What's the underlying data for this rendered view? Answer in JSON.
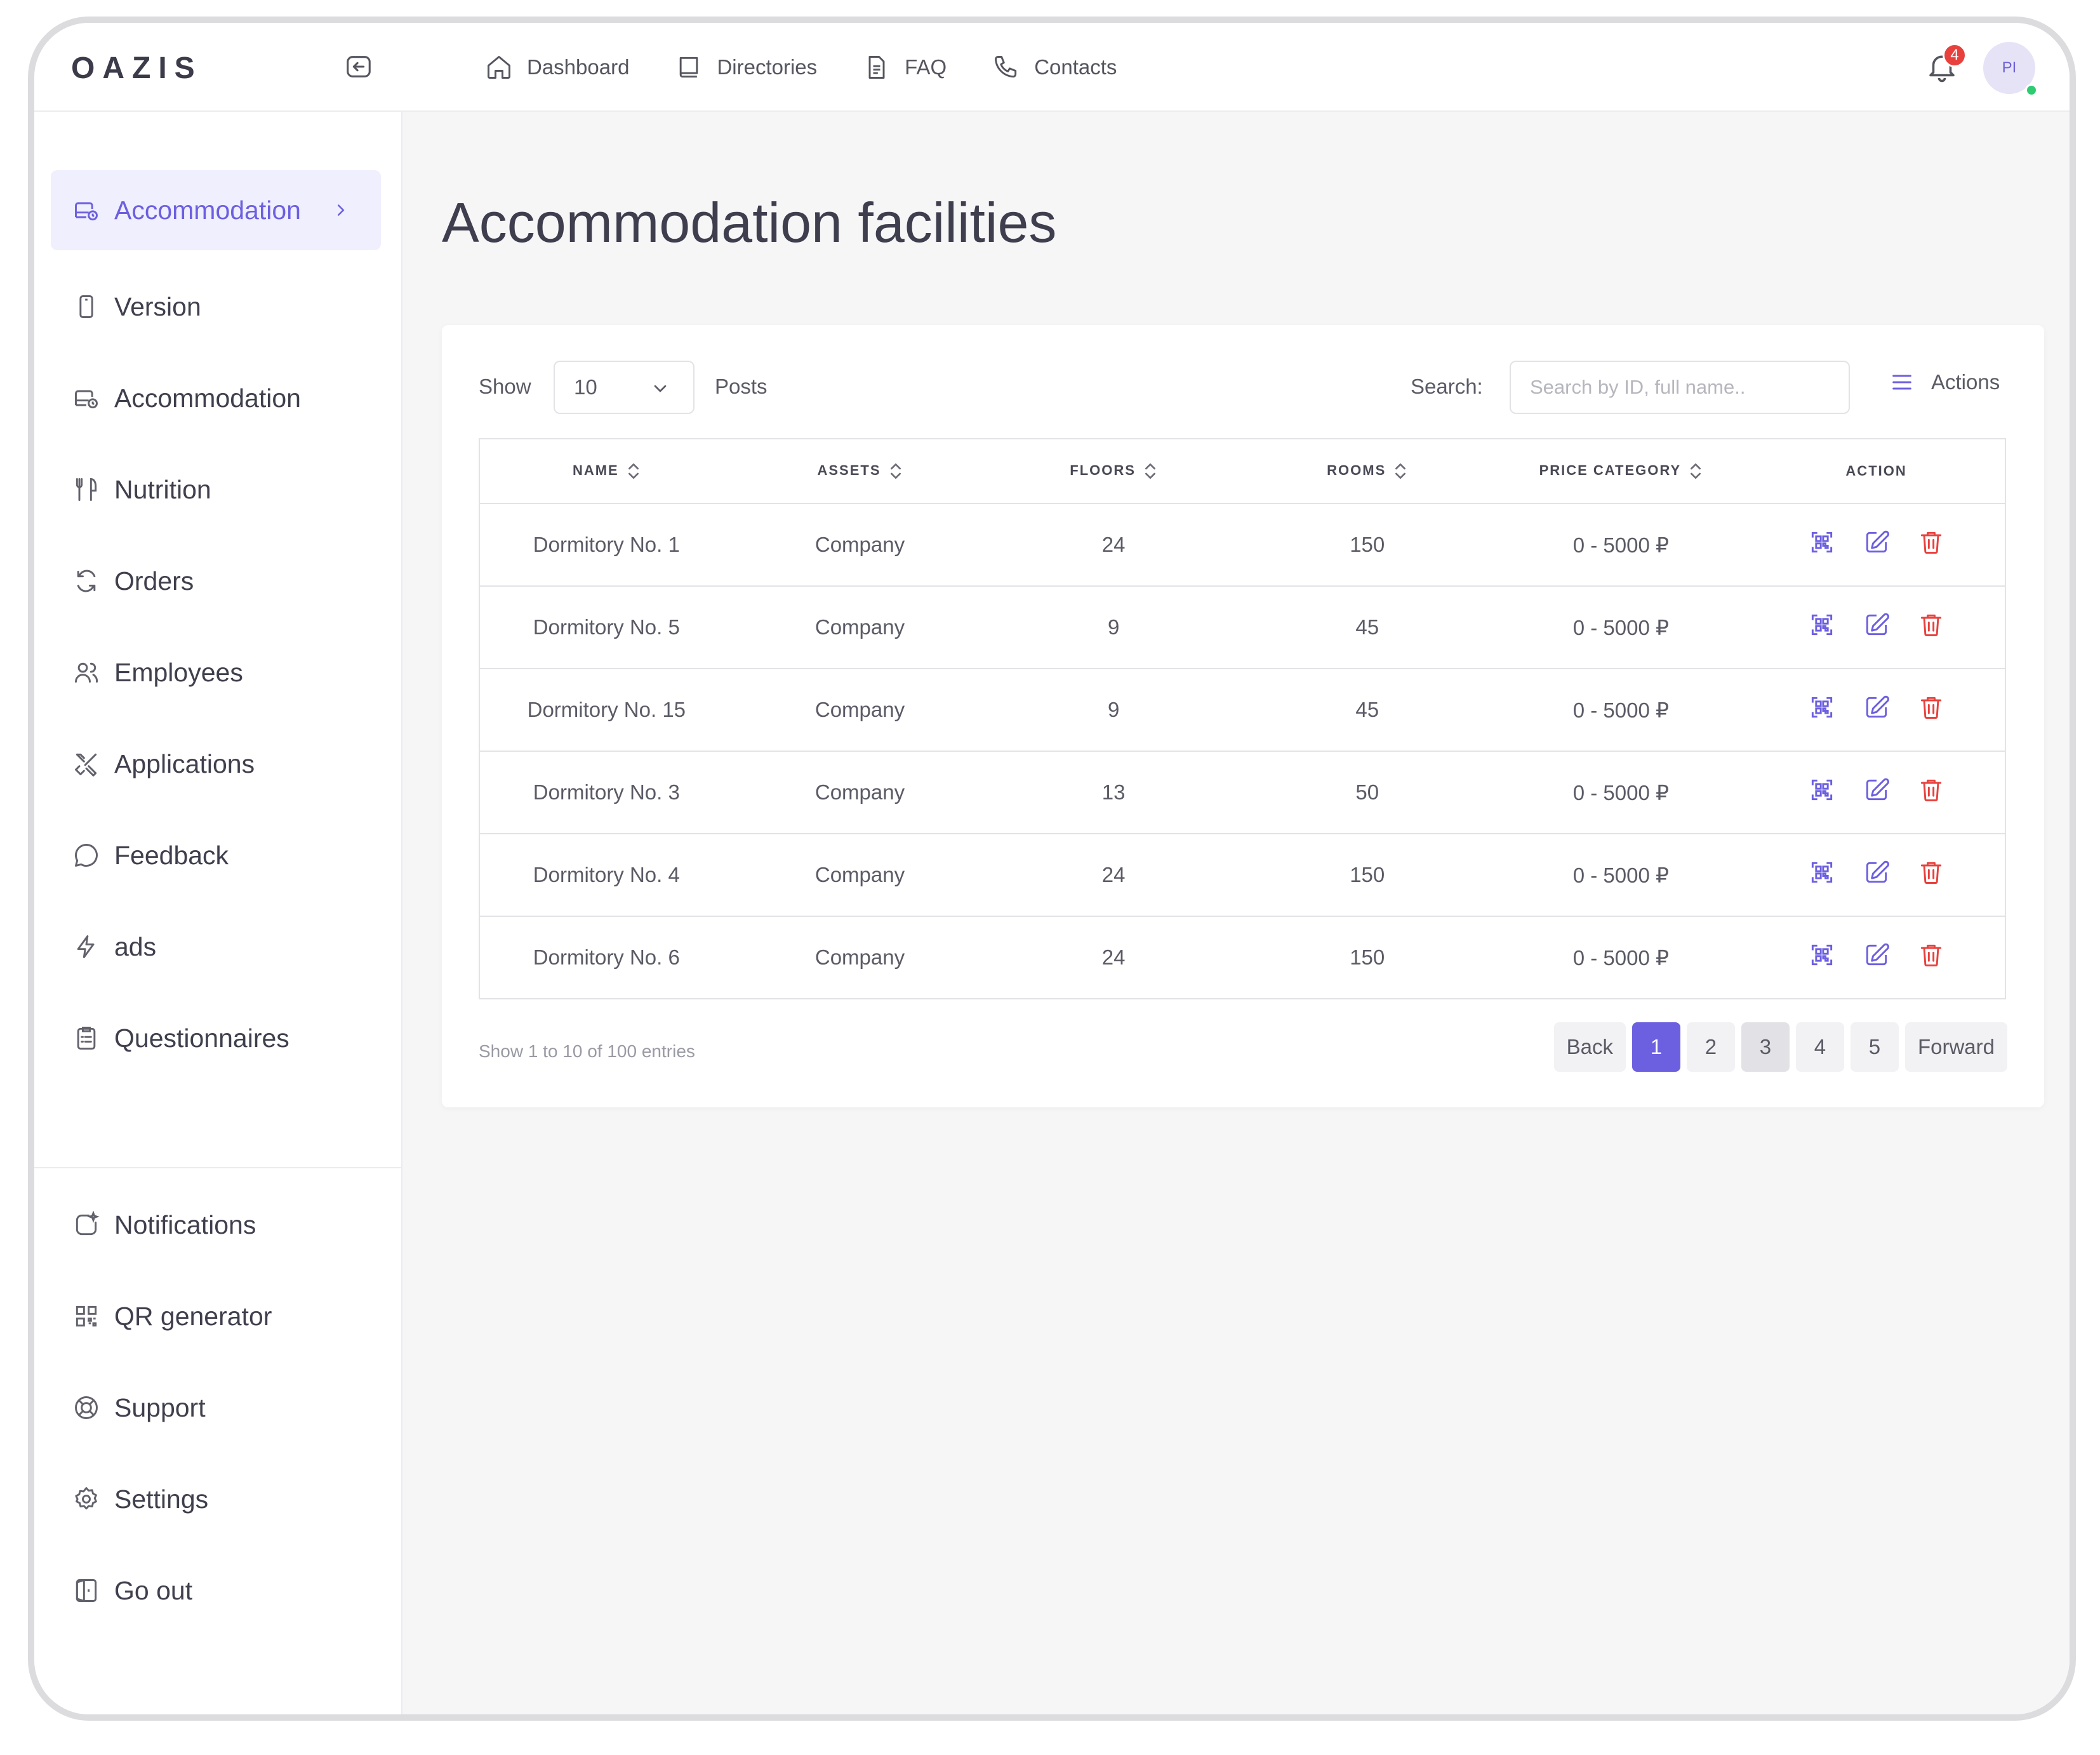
{
  "app": {
    "logo": "OAZIS"
  },
  "topnav": [
    {
      "label": "Dashboard"
    },
    {
      "label": "Directories"
    },
    {
      "label": "FAQ"
    },
    {
      "label": "Contacts"
    }
  ],
  "header": {
    "notifications_count": "4",
    "avatar_initials": "PI"
  },
  "sidebar": {
    "items": [
      {
        "label": "Accommodation",
        "icon": "bed-icon"
      },
      {
        "label": "Version",
        "icon": "phone-icon"
      },
      {
        "label": "Accommodation",
        "icon": "bed-icon"
      },
      {
        "label": "Nutrition",
        "icon": "utensils-icon"
      },
      {
        "label": "Orders",
        "icon": "refresh-icon"
      },
      {
        "label": "Employees",
        "icon": "users-icon"
      },
      {
        "label": "Applications",
        "icon": "tools-icon"
      },
      {
        "label": "Feedback",
        "icon": "chat-icon"
      },
      {
        "label": "ads",
        "icon": "bolt-icon"
      },
      {
        "label": "Questionnaires",
        "icon": "clipboard-icon"
      }
    ],
    "bottom_items": [
      {
        "label": "Notifications",
        "icon": "notification-icon"
      },
      {
        "label": "QR generator",
        "icon": "qr-icon"
      },
      {
        "label": "Support",
        "icon": "lifebuoy-icon"
      },
      {
        "label": "Settings",
        "icon": "gear-icon"
      },
      {
        "label": "Go out",
        "icon": "logout-icon"
      }
    ]
  },
  "main": {
    "title": "Accommodation facilities",
    "show_label": "Show",
    "page_size": "10",
    "posts_label": "Posts",
    "search_label": "Search:",
    "search_placeholder": "Search by ID, full name..",
    "actions_label": "Actions",
    "table": {
      "columns": [
        "NAME",
        "ASSETS",
        "FLOORS",
        "ROOMS",
        "PRICE CATEGORY",
        "ACTION"
      ],
      "rows": [
        [
          "Dormitory No. 1",
          "Company",
          "24",
          "150",
          "0 - 5000 ₽"
        ],
        [
          "Dormitory No. 5",
          "Company",
          "9",
          "45",
          "0 - 5000 ₽"
        ],
        [
          "Dormitory No. 15",
          "Company",
          "9",
          "45",
          "0 - 5000 ₽"
        ],
        [
          "Dormitory No. 3",
          "Company",
          "13",
          "50",
          "0 - 5000 ₽"
        ],
        [
          "Dormitory No. 4",
          "Company",
          "24",
          "150",
          "0 - 5000 ₽"
        ],
        [
          "Dormitory No. 6",
          "Company",
          "24",
          "150",
          "0 - 5000 ₽"
        ]
      ]
    },
    "entries_text": "Show 1 to 10 of 100 entries",
    "pagination": {
      "back": "Back",
      "pages": [
        "1",
        "2",
        "3",
        "4",
        "5"
      ],
      "forward": "Forward",
      "current": "1"
    }
  },
  "colors": {
    "accent": "#6c5fe0",
    "danger": "#e8413d",
    "online": "#2ecc71"
  }
}
